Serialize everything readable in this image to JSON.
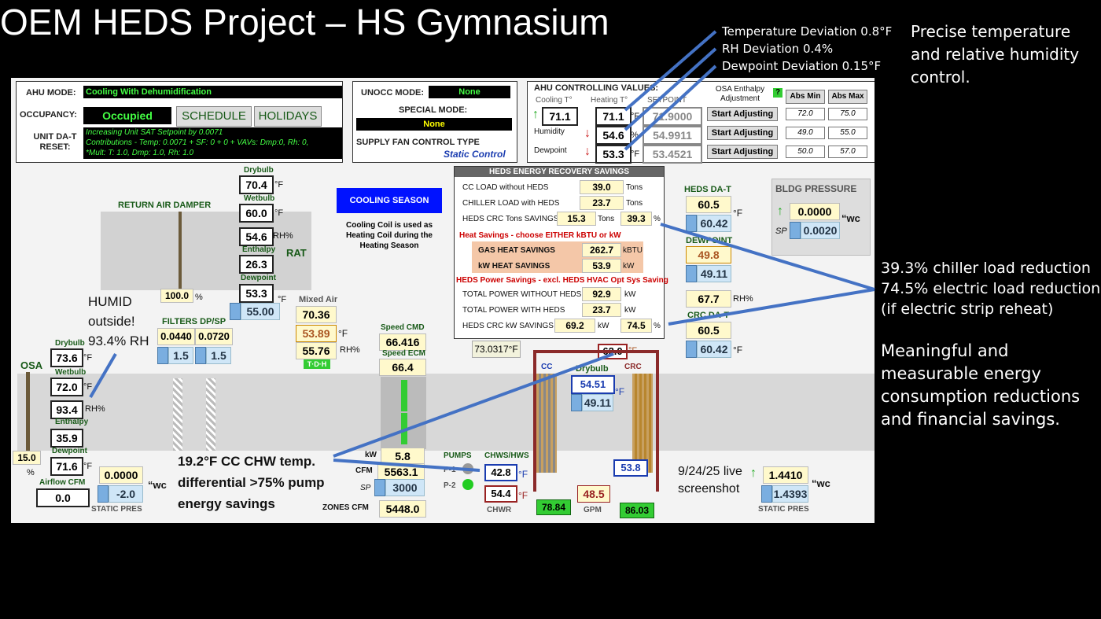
{
  "title": "OEM HEDS Project – HS Gymnasium",
  "top_notes": {
    "temp_dev": "Temperature Deviation 0.8°F",
    "rh_dev": "RH Deviation 0.4%",
    "dp_dev": "Dewpoint Deviation 0.15°F",
    "right": "Precise temperature and relative humidity control."
  },
  "side_notes": {
    "n1": "39.3% chiller load reduction",
    "n2": "74.5% electric load reduction",
    "n3": "(if electric strip reheat)",
    "n4": "Meaningful and measurable energy consumption reductions and financial savings."
  },
  "ahu": {
    "mode_label": "AHU MODE:",
    "mode": "Cooling With Dehumidification",
    "occ_label": "OCCUPANCY:",
    "occ": "Occupied",
    "schedule": "SCHEDULE",
    "holidays": "HOLIDAYS",
    "reset_label": "UNIT DA-T RESET:",
    "reset_line1": "Increasing Unit SAT Setpoint by 0.0071",
    "reset_line2": "Contributions - Temp: 0.0071 + SF: 0 + 0 + VAVs: Dmp:0, Rh: 0,",
    "reset_line3": "*Mult: T: 1.0, Dmp: 1.0, Rh: 1.0"
  },
  "unocc": {
    "label": "UNOCC MODE:",
    "value": "None",
    "special_label": "SPECIAL MODE:",
    "special": "None",
    "fan_label": "SUPPLY FAN CONTROL TYPE",
    "fan": "Static Control"
  },
  "ctrl": {
    "title": "AHU CONTROLLING VALUES:",
    "cooling_t": "Cooling T°",
    "heating_t": "Heating T°",
    "setpoint": "SETPOINT",
    "cool": "71.1",
    "heat": "71.1",
    "sp_temp": "71.9000",
    "humidity": "Humidity",
    "hum": "54.6",
    "sp_hum": "54.9911",
    "dewpoint": "Dewpoint",
    "dp": "53.3",
    "sp_dp": "53.4521",
    "osa_adj": "OSA Enthalpy Adjustment",
    "start": "Start Adjusting",
    "abs_min": "Abs Min",
    "abs_max": "Abs Max",
    "min1": "72.0",
    "max1": "75.0",
    "min2": "49.0",
    "max2": "55.0",
    "min3": "50.0",
    "max3": "57.0"
  },
  "rat": {
    "return_damper": "RETURN AIR DAMPER",
    "drybulb_l": "Drybulb",
    "drybulb": "70.4",
    "wetbulb_l": "Wetbulb",
    "wetbulb": "60.0",
    "rh": "54.6",
    "enthalpy_l": "Enthalpy",
    "enthalpy": "26.3",
    "dewpoint_l": "Dewpoint",
    "dewpoint": "53.3",
    "rat": "RAT",
    "damper_pct": "100.0",
    "sp": "55.00"
  },
  "season": {
    "label": "COOLING SEASON",
    "note": "Cooling Coil is used as Heating Coil during the Heating Season"
  },
  "heds": {
    "title": "HEDS ENERGY RECOVERY SAVINGS",
    "cc_load_l": "CC LOAD without HEDS",
    "cc_load": "39.0",
    "chiller_l": "CHILLER LOAD with HEDS",
    "chiller": "23.7",
    "crc_l": "HEDS CRC Tons SAVINGS",
    "crc": "15.3",
    "crc_pct": "39.3",
    "tons": "Tons",
    "heat_hdr": "Heat Savings - choose EITHER kBTU or kW",
    "gas_l": "GAS HEAT SAVINGS",
    "gas": "262.7",
    "kbtu": "kBTU",
    "kw_l": "kW HEAT SAVINGS",
    "kw": "53.9",
    "power_hdr": "HEDS Power Savings - excl. HEDS HVAC Opt Sys Saving",
    "tp_wo_l": "TOTAL POWER WITHOUT HEDS",
    "tp_wo": "92.9",
    "tp_w_l": "TOTAL POWER WITH HEDS",
    "tp_w": "23.7",
    "kw_sav_l": "HEDS CRC kW SAVINGS",
    "kw_sav": "69.2",
    "kw_pct": "74.5",
    "kwu": "kW"
  },
  "dat": {
    "heds_dat": "HEDS DA-T",
    "heds_dat_v": "60.5",
    "heds_dat_sp": "60.42",
    "dewpoint_l": "DEWPOINT",
    "dp": "49.8",
    "dp_sp": "49.11",
    "rh": "67.7",
    "crc_dat": "CRC DA-T",
    "crc_v": "60.5",
    "crc_sp": "60.42"
  },
  "bldg": {
    "label": "BLDG PRESSURE",
    "v": "0.0000",
    "sp": "0.0020",
    "unit": "“wc"
  },
  "osa": {
    "label": "OSA",
    "drybulb_l": "Drybulb",
    "drybulb": "73.6",
    "wetbulb_l": "Wetbulb",
    "wetbulb": "72.0",
    "rh": "93.4",
    "enthalpy_l": "Enthalpy",
    "enthalpy": "35.9",
    "dewpoint_l": "Dewpoint",
    "dewpoint": "71.6",
    "pct": "15.0",
    "cfm_l": "Airflow CFM",
    "cfm": "0.0",
    "static": "0.0000",
    "static_sp": "-2.0",
    "static_l": "STATIC PRES"
  },
  "humid_note": "HUMID outside! 93.4% RH",
  "filters": {
    "label": "FILTERS DP/SP",
    "f1": "0.0440",
    "f2": "0.0720",
    "sp1": "1.5",
    "sp2": "1.5"
  },
  "mixed": {
    "label": "Mixed Air",
    "v1": "70.36",
    "v2": "53.89",
    "v3": "55.76"
  },
  "fan": {
    "cmd_l": "Speed CMD",
    "cmd": "66.416",
    "ecm_l": "Speed ECM",
    "ecm": "66.4",
    "kw": "5.8",
    "cfm": "5563.1",
    "sp": "3000",
    "zones": "5448.0",
    "zones_l": "ZONES CFM"
  },
  "coil": {
    "cc": "CC",
    "crc": "CRC",
    "drybulb_l": "Drybulb",
    "temp_top": "73.0317°F",
    "leave": "62.0",
    "db": "54.51",
    "db_sp": "49.11",
    "chws": "42.8",
    "chwr": "54.4",
    "gpm": "48.5",
    "gpm_l": "GPM",
    "v1": "78.84",
    "v2": "86.03",
    "crc_in": "53.8",
    "pumps": "PUMPS",
    "chws_l": "CHWS/HWS",
    "chwr_l": "CHWR",
    "p1": "P-1",
    "p2": "P-2"
  },
  "chw_note": "19.2°F CC CHW temp. differential >75% pump energy savings",
  "live_note": "9/24/25 live screenshot",
  "sp_right": {
    "v": "1.4410",
    "sp": "1.4393",
    "label": "STATIC PRES"
  },
  "units": {
    "f": "°F",
    "rh": "RH%",
    "pct": "%",
    "wc": "“wc",
    "sp": "SP",
    "kw_l": "kW",
    "cfm_l": "CFM"
  }
}
